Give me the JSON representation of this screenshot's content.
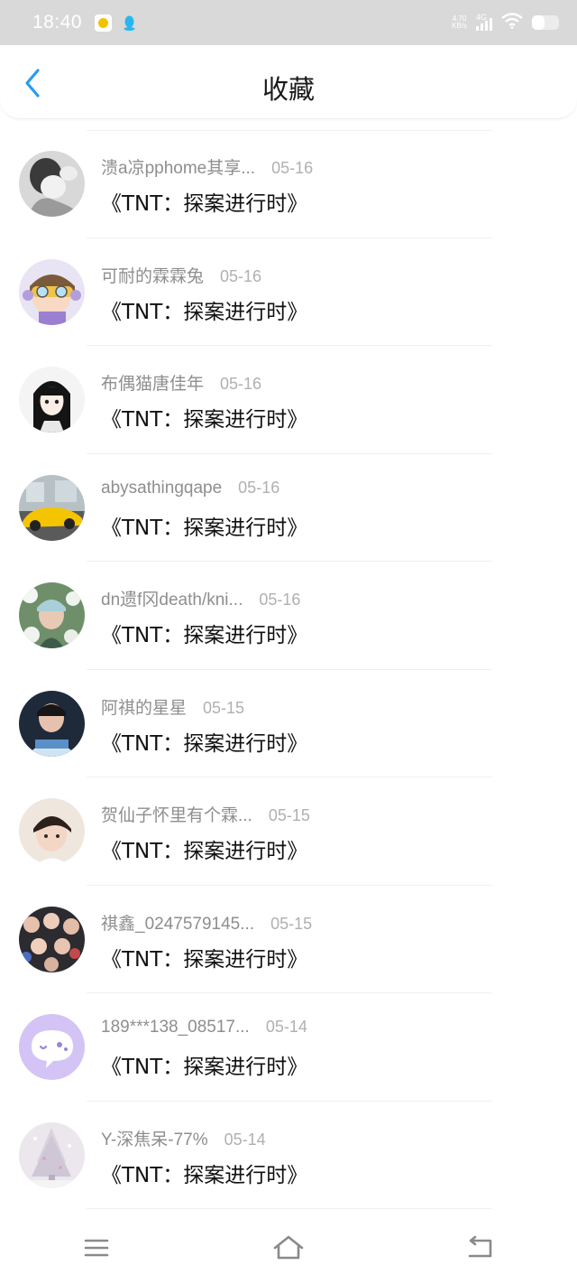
{
  "status_bar": {
    "time": "18:40",
    "net_speed_value": "4.70",
    "net_speed_unit": "KB/s",
    "network_type": "4G",
    "battery_level": 0.45
  },
  "header": {
    "title": "收藏",
    "accent_color": "#2a9bef"
  },
  "favorites": [
    {
      "name": "溃a凉pphome其享...",
      "date": "05-16",
      "content": "《TNT：探案进行时》",
      "avatar": "grayscale-girl"
    },
    {
      "name": "可耐的霖霖兔",
      "date": "05-16",
      "content": "《TNT：探案进行时》",
      "avatar": "cartoon-goggles"
    },
    {
      "name": "布偶猫唐佳年",
      "date": "05-16",
      "content": "《TNT：探案进行时》",
      "avatar": "anime-girl"
    },
    {
      "name": "abysathingqape",
      "date": "05-16",
      "content": "《TNT：探案进行时》",
      "avatar": "yellow-car"
    },
    {
      "name": "dn遗f冈death/kni...",
      "date": "05-16",
      "content": "《TNT：探案进行时》",
      "avatar": "flowers-portrait"
    },
    {
      "name": "阿祺的星星",
      "date": "05-15",
      "content": "《TNT：探案进行时》",
      "avatar": "stage-portrait"
    },
    {
      "name": "贺仙子怀里有个霖...",
      "date": "05-15",
      "content": "《TNT：探案进行时》",
      "avatar": "boy-portrait"
    },
    {
      "name": "祺鑫_0247579145...",
      "date": "05-15",
      "content": "《TNT：探案进行时》",
      "avatar": "group-photo"
    },
    {
      "name": "189***138_08517...",
      "date": "05-14",
      "content": "《TNT：探案进行时》",
      "avatar": "purple-chat-bubble"
    },
    {
      "name": "Y-深焦呆-77%",
      "date": "05-14",
      "content": "《TNT：探案进行时》",
      "avatar": "winter-tree"
    }
  ],
  "nav_bar": {
    "menu_icon": "menu-icon",
    "home_icon": "home-icon",
    "back_icon": "back-icon"
  }
}
